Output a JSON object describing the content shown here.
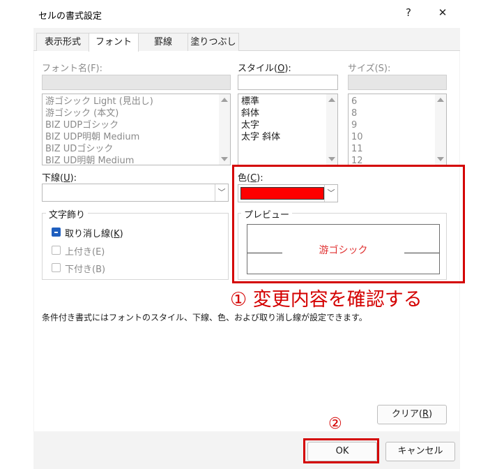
{
  "window": {
    "title": "セルの書式設定",
    "help_label": "?",
    "close_label": "✕"
  },
  "tabs": [
    {
      "label": "表示形式"
    },
    {
      "label": "フォント"
    },
    {
      "label": "罫線"
    },
    {
      "label": "塗りつぶし"
    }
  ],
  "font": {
    "label": "フォント名(F):",
    "value": "",
    "items": [
      "游ゴシック Light (見出し)",
      "游ゴシック (本文)",
      "BIZ UDPゴシック",
      "BIZ UDP明朝 Medium",
      "BIZ UDゴシック",
      "BIZ UD明朝 Medium"
    ]
  },
  "style": {
    "label_prefix": "スタイル(",
    "label_key": "O",
    "label_suffix": "):",
    "value": "",
    "items": [
      "標準",
      "斜体",
      "太字",
      "太字 斜体"
    ]
  },
  "size": {
    "label": "サイズ(S):",
    "value": "",
    "items": [
      "6",
      "8",
      "9",
      "10",
      "11",
      "12"
    ]
  },
  "underline": {
    "label_prefix": "下線(",
    "label_key": "U",
    "label_suffix": "):",
    "value": ""
  },
  "color": {
    "label_prefix": "色(",
    "label_key": "C",
    "label_suffix": "):",
    "swatch": "#ff0000",
    "dropdown_glyph": "﹀"
  },
  "effects": {
    "label": "文字飾り",
    "strike_prefix": "取り消し線(",
    "strike_key": "K",
    "strike_suffix": ")",
    "strike_checked": true,
    "superscript": "上付き(E)",
    "subscript": "下付き(B)"
  },
  "preview": {
    "label": "プレビュー",
    "text": "游ゴシック",
    "text_color": "#e03030"
  },
  "note": "条件付き書式にはフォントのスタイル、下線、色、および取り消し線が設定できます。",
  "clear_prefix": "クリア(",
  "clear_key": "R",
  "clear_suffix": ")",
  "ok_label": "OK",
  "cancel_label": "キャンセル",
  "annotations": {
    "step1": "① 変更内容を確認する",
    "step2": "②",
    "color": "#d40000"
  }
}
